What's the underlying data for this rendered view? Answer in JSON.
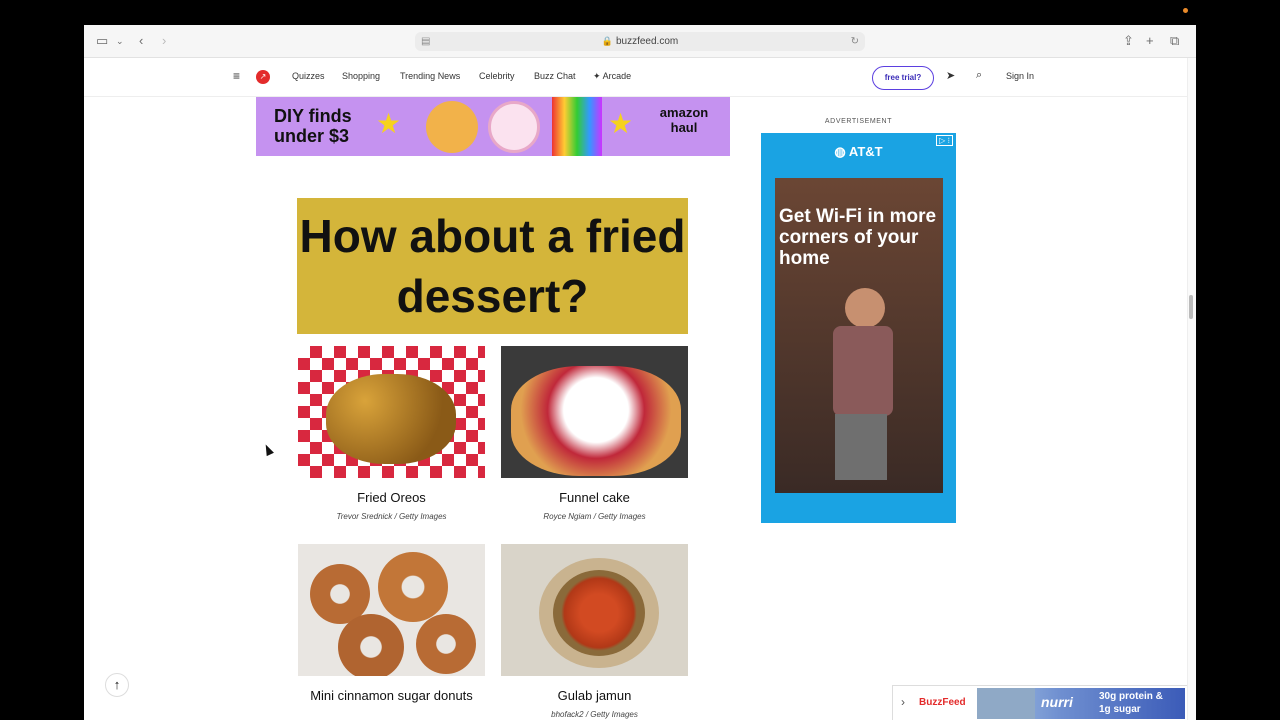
{
  "browser": {
    "url": "buzzfeed.com"
  },
  "nav": {
    "items": [
      "Quizzes",
      "Shopping",
      "Trending News",
      "Celebrity",
      "Buzz Chat",
      "Arcade"
    ],
    "trial_label": "free trial?",
    "signin_label": "Sign In"
  },
  "banner_ad": {
    "left_text": "DIY finds under $3",
    "right_text": "amazon haul"
  },
  "headline": "How about a fried dessert?",
  "cards": [
    {
      "title": "Fried Oreos",
      "credit": "Trevor Srednick / Getty Images"
    },
    {
      "title": "Funnel cake",
      "credit": "Royce Ngiam / Getty Images"
    },
    {
      "title": "Mini cinnamon sugar donuts",
      "credit": ""
    },
    {
      "title": "Gulab jamun",
      "credit": "bhofack2 / Getty Images"
    }
  ],
  "side_ad": {
    "label": "ADVERTISEMENT",
    "brand": "AT&T",
    "copy": "Get Wi-Fi in more corners of your home"
  },
  "bottom_ad": {
    "brand": "BuzzFeed",
    "product": "nurri",
    "claim": "30g protein & 1g sugar"
  },
  "colors": {
    "brand_red": "#e32b2b",
    "headline_bg": "#d4b53a",
    "banner_bg": "#c592f0",
    "att_blue": "#1aa3e3",
    "trial_purple": "#5b3fe0"
  }
}
